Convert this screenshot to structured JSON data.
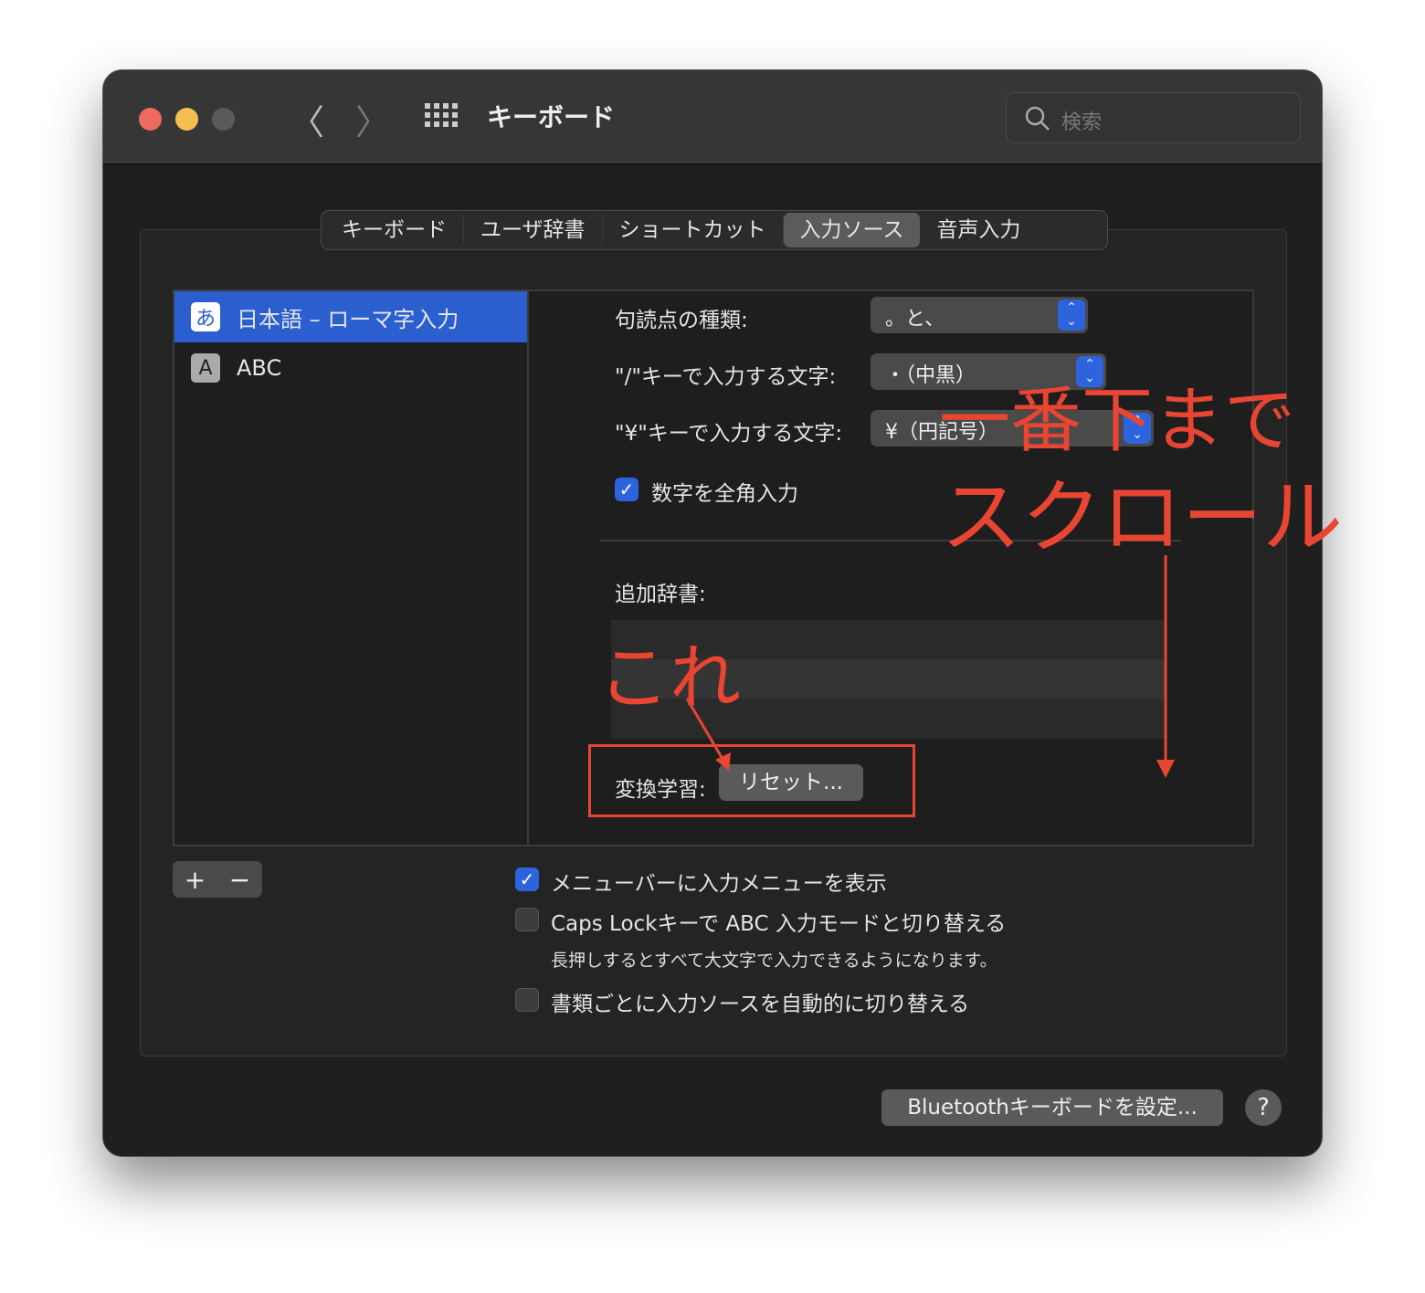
{
  "window": {
    "title": "キーボード",
    "search_placeholder": "検索"
  },
  "tabs": [
    {
      "label": "キーボード"
    },
    {
      "label": "ユーザ辞書"
    },
    {
      "label": "ショートカット"
    },
    {
      "label": "入力ソース",
      "active": true
    },
    {
      "label": "音声入力"
    }
  ],
  "sources": [
    {
      "badge": "あ",
      "label": "日本語 – ローマ字入力",
      "selected": true
    },
    {
      "badge": "A",
      "label": "ABC"
    }
  ],
  "settings": {
    "punct_label": "句読点の種類:",
    "punct_value": "。と、",
    "slash_label": "\"/\"キーで入力する文字:",
    "slash_value": "・（中黒）",
    "yen_label": "\"¥\"キーで入力する文字:",
    "yen_value": "¥（円記号）",
    "fullwidth_label": "数字を全角入力",
    "fullwidth_checked": true,
    "dict_label": "追加辞書:",
    "learning_label": "変換学習:",
    "reset_label": "リセット..."
  },
  "bottom": {
    "add": "+",
    "remove": "−",
    "menu_label": "メニューバーに入力メニューを表示",
    "menu_checked": true,
    "caps_label": "Caps Lockキーで ABC 入力モードと切り替える",
    "caps_checked": false,
    "caps_note": "長押しするとすべて大文字で入力できるようになります。",
    "auto_label": "書類ごとに入力ソースを自動的に切り替える",
    "auto_checked": false,
    "bluetooth_label": "Bluetoothキーボードを設定...",
    "help": "?"
  },
  "annotations": {
    "line1": "一番下まで",
    "line2": "スクロール",
    "this": "これ",
    "color": "#e84533"
  }
}
